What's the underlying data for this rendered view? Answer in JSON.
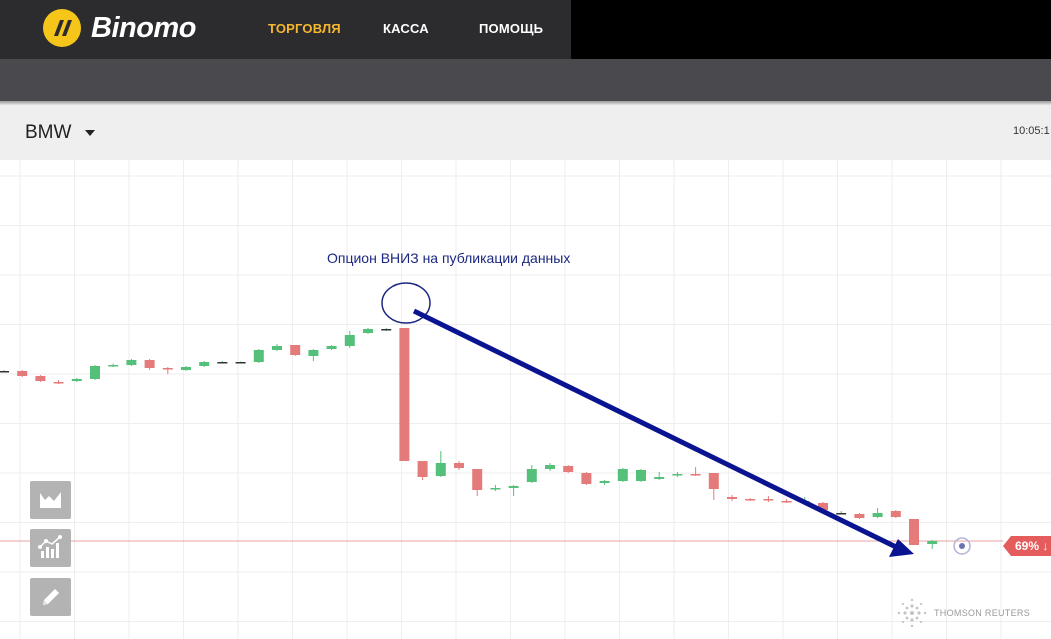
{
  "header": {
    "brand": "Binomo",
    "nav": [
      "ТОРГОВЛЯ",
      "КАССА",
      "ПОМОЩЬ"
    ],
    "active_nav": "ТОРГОВЛЯ",
    "accent_color": "#f5b82e"
  },
  "asset_bar": {
    "asset": "BMW",
    "time": "10:05:1"
  },
  "tools": [
    {
      "name": "chart-type",
      "icon": "area-chart-icon"
    },
    {
      "name": "indicators",
      "icon": "indicators-icon"
    },
    {
      "name": "drawing",
      "icon": "pencil-icon"
    }
  ],
  "annotation": {
    "text": "Опцион ВНИЗ на публикации данных",
    "color": "#1b2780"
  },
  "price_tag": {
    "label": "69%",
    "arrow": "↓",
    "color": "#e45c5c"
  },
  "provider": "THOMSON REUTERS",
  "colors": {
    "up": "#55c07a",
    "down": "#e57a7a",
    "grid": "#eeeeee",
    "price_line": "#e8a0a0"
  },
  "chart_data": {
    "type": "candlestick",
    "candles": [
      {
        "o": 0.0,
        "c": 0.0,
        "h": 0.02,
        "l": -0.02
      },
      {
        "o": 0.0,
        "c": -0.1,
        "h": 0.02,
        "l": -0.12
      },
      {
        "o": -0.1,
        "c": -0.2,
        "h": -0.08,
        "l": -0.22
      },
      {
        "o": -0.22,
        "c": -0.24,
        "h": -0.18,
        "l": -0.26
      },
      {
        "o": -0.2,
        "c": -0.16,
        "h": -0.14,
        "l": -0.22
      },
      {
        "o": -0.16,
        "c": 0.1,
        "h": 0.12,
        "l": -0.18
      },
      {
        "o": 0.1,
        "c": 0.12,
        "h": 0.15,
        "l": 0.08
      },
      {
        "o": 0.12,
        "c": 0.22,
        "h": 0.24,
        "l": 0.1
      },
      {
        "o": 0.22,
        "c": 0.06,
        "h": 0.24,
        "l": 0.02
      },
      {
        "o": 0.06,
        "c": 0.04,
        "h": 0.08,
        "l": -0.06
      },
      {
        "o": 0.02,
        "c": 0.08,
        "h": 0.1,
        "l": 0.0
      },
      {
        "o": 0.1,
        "c": 0.18,
        "h": 0.2,
        "l": 0.08
      },
      {
        "o": 0.18,
        "c": 0.18,
        "h": 0.2,
        "l": 0.16
      },
      {
        "o": 0.18,
        "c": 0.18,
        "h": 0.19,
        "l": 0.17
      },
      {
        "o": 0.18,
        "c": 0.42,
        "h": 0.44,
        "l": 0.16
      },
      {
        "o": 0.42,
        "c": 0.5,
        "h": 0.54,
        "l": 0.4
      },
      {
        "o": 0.52,
        "c": 0.32,
        "h": 0.52,
        "l": 0.3
      },
      {
        "o": 0.3,
        "c": 0.42,
        "h": 0.44,
        "l": 0.2
      },
      {
        "o": 0.44,
        "c": 0.5,
        "h": 0.52,
        "l": 0.42
      },
      {
        "o": 0.5,
        "c": 0.72,
        "h": 0.8,
        "l": 0.46
      },
      {
        "o": 0.76,
        "c": 0.84,
        "h": 0.86,
        "l": 0.74
      },
      {
        "o": 0.84,
        "c": 0.84,
        "h": 0.86,
        "l": 0.8
      },
      {
        "o": 0.86,
        "c": -1.8,
        "h": 0.86,
        "l": -1.8
      },
      {
        "o": -1.8,
        "c": -2.12,
        "h": -1.8,
        "l": -2.18
      },
      {
        "o": -2.1,
        "c": -1.84,
        "h": -1.6,
        "l": -2.12
      },
      {
        "o": -1.84,
        "c": -1.94,
        "h": -1.8,
        "l": -1.98
      },
      {
        "o": -1.96,
        "c": -2.38,
        "h": -1.96,
        "l": -2.5
      },
      {
        "o": -2.36,
        "c": -2.34,
        "h": -2.28,
        "l": -2.4
      },
      {
        "o": -2.34,
        "c": -2.3,
        "h": -2.28,
        "l": -2.5
      },
      {
        "o": -2.22,
        "c": -1.96,
        "h": -1.88,
        "l": -2.24
      },
      {
        "o": -1.96,
        "c": -1.88,
        "h": -1.84,
        "l": -2.0
      },
      {
        "o": -1.9,
        "c": -2.02,
        "h": -1.88,
        "l": -2.04
      },
      {
        "o": -2.04,
        "c": -2.26,
        "h": -2.02,
        "l": -2.28
      },
      {
        "o": -2.24,
        "c": -2.2,
        "h": -2.18,
        "l": -2.28
      },
      {
        "o": -2.2,
        "c": -1.96,
        "h": -1.94,
        "l": -2.22
      },
      {
        "o": -2.2,
        "c": -1.98,
        "h": -1.96,
        "l": -2.22
      },
      {
        "o": -2.16,
        "c": -2.12,
        "h": -2.02,
        "l": -2.18
      },
      {
        "o": -2.08,
        "c": -2.06,
        "h": -2.02,
        "l": -2.12
      },
      {
        "o": -2.06,
        "c": -2.08,
        "h": -1.92,
        "l": -2.1
      },
      {
        "o": -2.04,
        "c": -2.36,
        "h": -2.04,
        "l": -2.58
      },
      {
        "o": -2.52,
        "c": -2.56,
        "h": -2.48,
        "l": -2.6
      },
      {
        "o": -2.56,
        "c": -2.58,
        "h": -2.54,
        "l": -2.6
      },
      {
        "o": -2.56,
        "c": -2.58,
        "h": -2.5,
        "l": -2.62
      },
      {
        "o": -2.6,
        "c": -2.62,
        "h": -2.56,
        "l": -2.64
      },
      {
        "o": -2.62,
        "c": -2.6,
        "h": -2.52,
        "l": -2.64
      },
      {
        "o": -2.64,
        "c": -2.78,
        "h": -2.62,
        "l": -2.8
      },
      {
        "o": -2.84,
        "c": -2.84,
        "h": -2.8,
        "l": -2.86
      },
      {
        "o": -2.86,
        "c": -2.94,
        "h": -2.84,
        "l": -2.96
      },
      {
        "o": -2.92,
        "c": -2.84,
        "h": -2.74,
        "l": -2.94
      },
      {
        "o": -2.8,
        "c": -2.92,
        "h": -2.78,
        "l": -2.94
      },
      {
        "o": -2.96,
        "c": -3.48,
        "h": -2.96,
        "l": -3.48
      },
      {
        "o": -3.46,
        "c": -3.4,
        "h": -3.38,
        "l": -3.56
      }
    ],
    "current_price": -3.4,
    "grid": true
  }
}
